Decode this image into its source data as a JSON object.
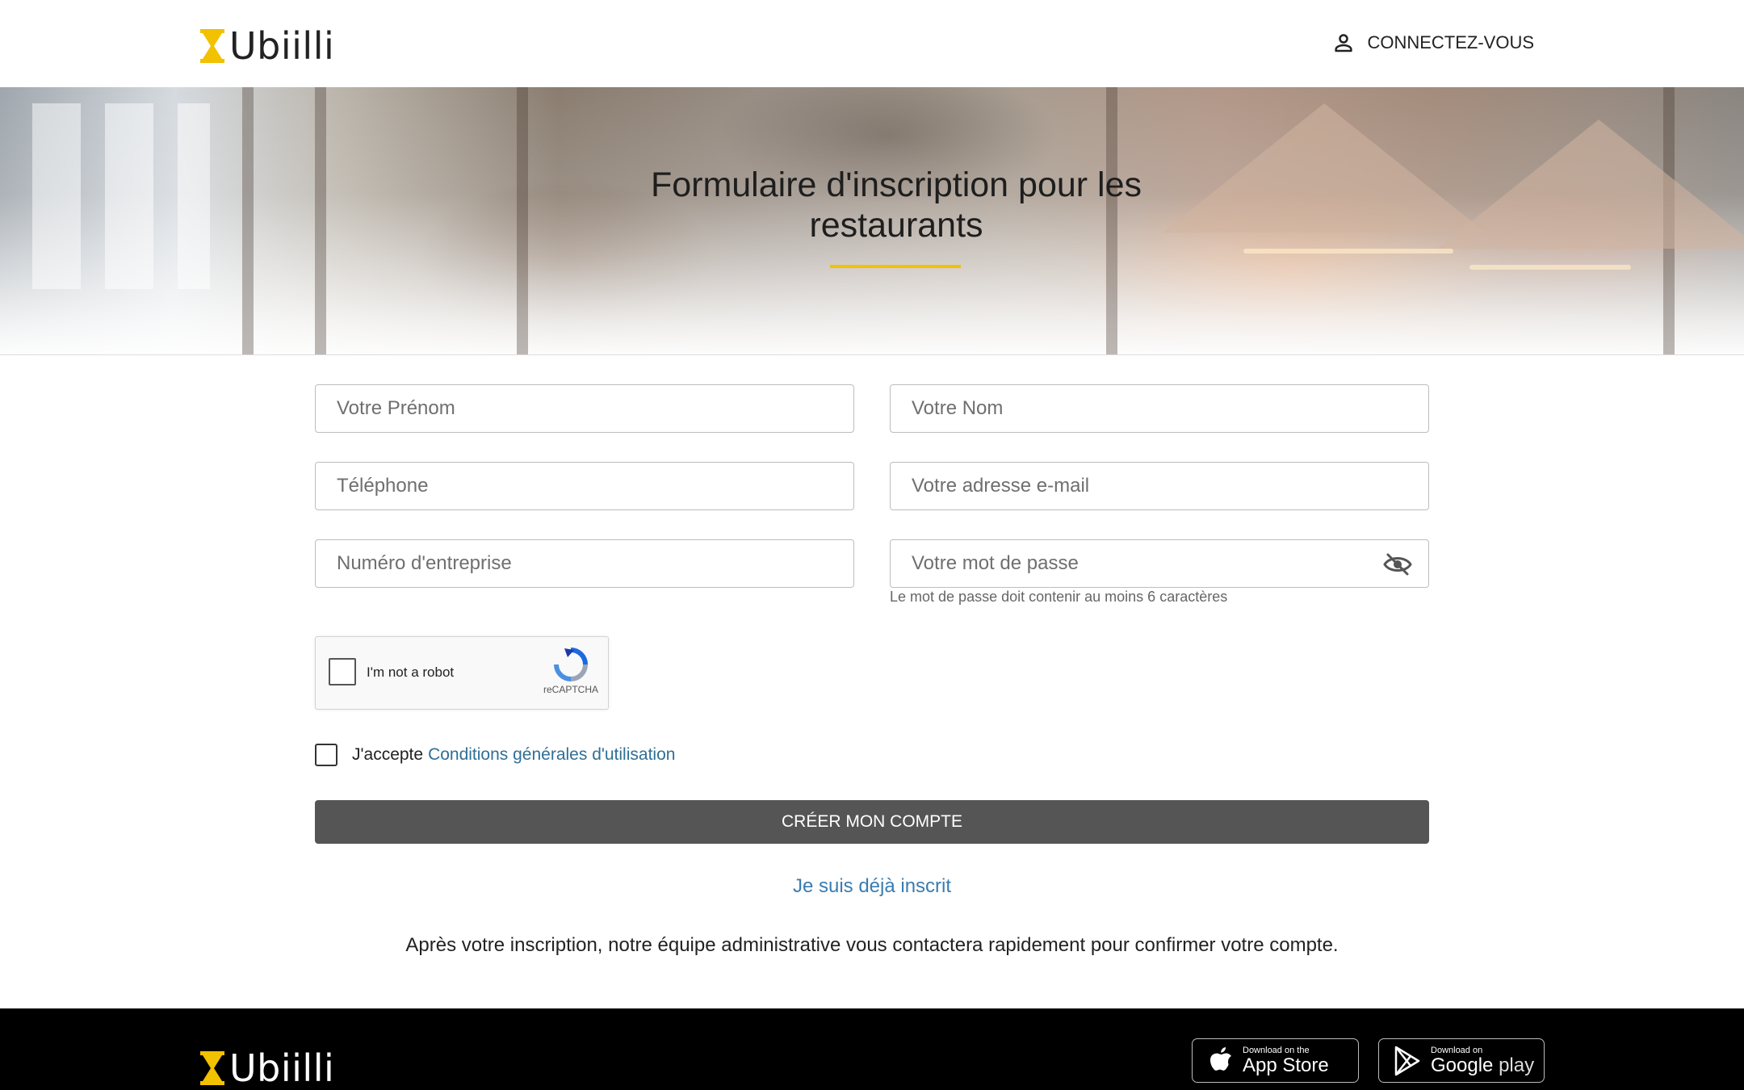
{
  "brand": {
    "name": "Ubiilli",
    "accent_color": "#f2c100"
  },
  "header": {
    "login_label": "CONNECTEZ-VOUS",
    "login_icon": "person-icon"
  },
  "hero": {
    "title_line1": "Formulaire d'inscription pour les",
    "title_line2": "restaurants"
  },
  "form": {
    "first_name_placeholder": "Votre Prénom",
    "last_name_placeholder": "Votre Nom",
    "phone_placeholder": "Téléphone",
    "email_placeholder": "Votre adresse e-mail",
    "company_number_placeholder": "Numéro d'entreprise",
    "password_placeholder": "Votre mot de passe",
    "password_toggle_icon": "eye-off-icon",
    "password_hint": "Le mot de passe doit contenir au moins 6 caractères",
    "recaptcha_label": "I'm not a robot",
    "recaptcha_brand": "reCAPTCHA",
    "terms_prefix": "J'accepte",
    "terms_link": "Conditions générales d'utilisation",
    "submit_label": "CRÉER MON COMPTE",
    "submit_color": "#555555",
    "already_registered": "Je suis déjà inscrit",
    "info_text": "Après votre inscription, notre équipe administrative vous contactera rapidement pour confirmer votre compte."
  },
  "footer": {
    "app_store_small": "Download on the",
    "app_store_big": "App Store",
    "google_play_small": "Download on",
    "google_play_big_1": "Google",
    "google_play_big_2": "play"
  }
}
